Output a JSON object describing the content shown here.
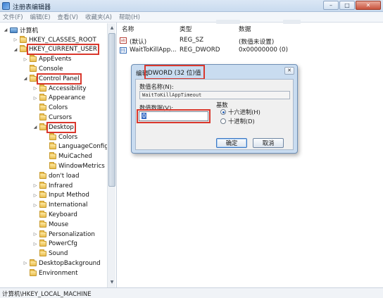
{
  "window": {
    "title": "注册表编辑器",
    "controls": {
      "minimize": "–",
      "maximize": "□",
      "close": "✕"
    }
  },
  "menu": [
    "文件(F)",
    "编辑(E)",
    "查看(V)",
    "收藏夹(A)",
    "帮助(H)"
  ],
  "tree": {
    "root": "计算机",
    "items": [
      {
        "label": "HKEY_CLASSES_ROOT",
        "expander": "▷",
        "highlighted": false
      },
      {
        "label": "HKEY_CURRENT_USER",
        "expander": "◢",
        "highlighted": true
      },
      {
        "label": "AppEvents",
        "expander": "▷",
        "highlighted": false
      },
      {
        "label": "Console",
        "expander": "",
        "highlighted": false
      },
      {
        "label": "Control Panel",
        "expander": "◢",
        "highlighted": true
      },
      {
        "label": "Accessibility",
        "expander": "▷",
        "highlighted": false
      },
      {
        "label": "Appearance",
        "expander": "▷",
        "highlighted": false
      },
      {
        "label": "Colors",
        "expander": "",
        "highlighted": false
      },
      {
        "label": "Cursors",
        "expander": "",
        "highlighted": false
      },
      {
        "label": "Desktop",
        "expander": "◢",
        "highlighted": true
      },
      {
        "label": "Colors",
        "expander": "",
        "highlighted": false
      },
      {
        "label": "LanguageConfig",
        "expander": "",
        "highlighted": false
      },
      {
        "label": "MuiCached",
        "expander": "",
        "highlighted": false
      },
      {
        "label": "WindowMetrics",
        "expander": "",
        "highlighted": false
      },
      {
        "label": "don't load",
        "expander": "",
        "highlighted": false
      },
      {
        "label": "Infrared",
        "expander": "▷",
        "highlighted": false
      },
      {
        "label": "Input Method",
        "expander": "▷",
        "highlighted": false
      },
      {
        "label": "International",
        "expander": "▷",
        "highlighted": false
      },
      {
        "label": "Keyboard",
        "expander": "",
        "highlighted": false
      },
      {
        "label": "Mouse",
        "expander": "",
        "highlighted": false
      },
      {
        "label": "Personalization",
        "expander": "▷",
        "highlighted": false
      },
      {
        "label": "PowerCfg",
        "expander": "▷",
        "highlighted": false
      },
      {
        "label": "Sound",
        "expander": "",
        "highlighted": false
      },
      {
        "label": "DesktopBackground",
        "expander": "▷",
        "highlighted": false
      },
      {
        "label": "Environment",
        "expander": "",
        "highlighted": false
      }
    ]
  },
  "list": {
    "columns": {
      "name": "名称",
      "type": "类型",
      "data": "数据"
    },
    "rows": [
      {
        "icon": "string-value-icon",
        "icon_text": "ab",
        "name": "(默认)",
        "type": "REG_SZ",
        "data": "(数值未设置)"
      },
      {
        "icon": "dword-value-icon",
        "icon_text": "01",
        "name": "WaitToKillApp...",
        "type": "REG_DWORD",
        "data": "0x00000000 (0)"
      }
    ]
  },
  "dialog": {
    "title_prefix": "编辑",
    "title": "DWORD (32 位)值",
    "close": "✕",
    "name_label": "数值名称(N):",
    "name_value": "WaitToKillAppTimeout",
    "data_label": "数值数据(V):",
    "data_value": "0",
    "radix_label": "基数",
    "radix_hex": "十六进制(H)",
    "radix_dec": "十进制(D)",
    "radix_selected": "hex",
    "ok": "确定",
    "cancel": "取消"
  },
  "status": "计算机\\HKEY_LOCAL_MACHINE",
  "colors": {
    "highlight_box": "#d9372c",
    "selection": "#3a6fc7",
    "titlebar": "#c9dbef"
  }
}
